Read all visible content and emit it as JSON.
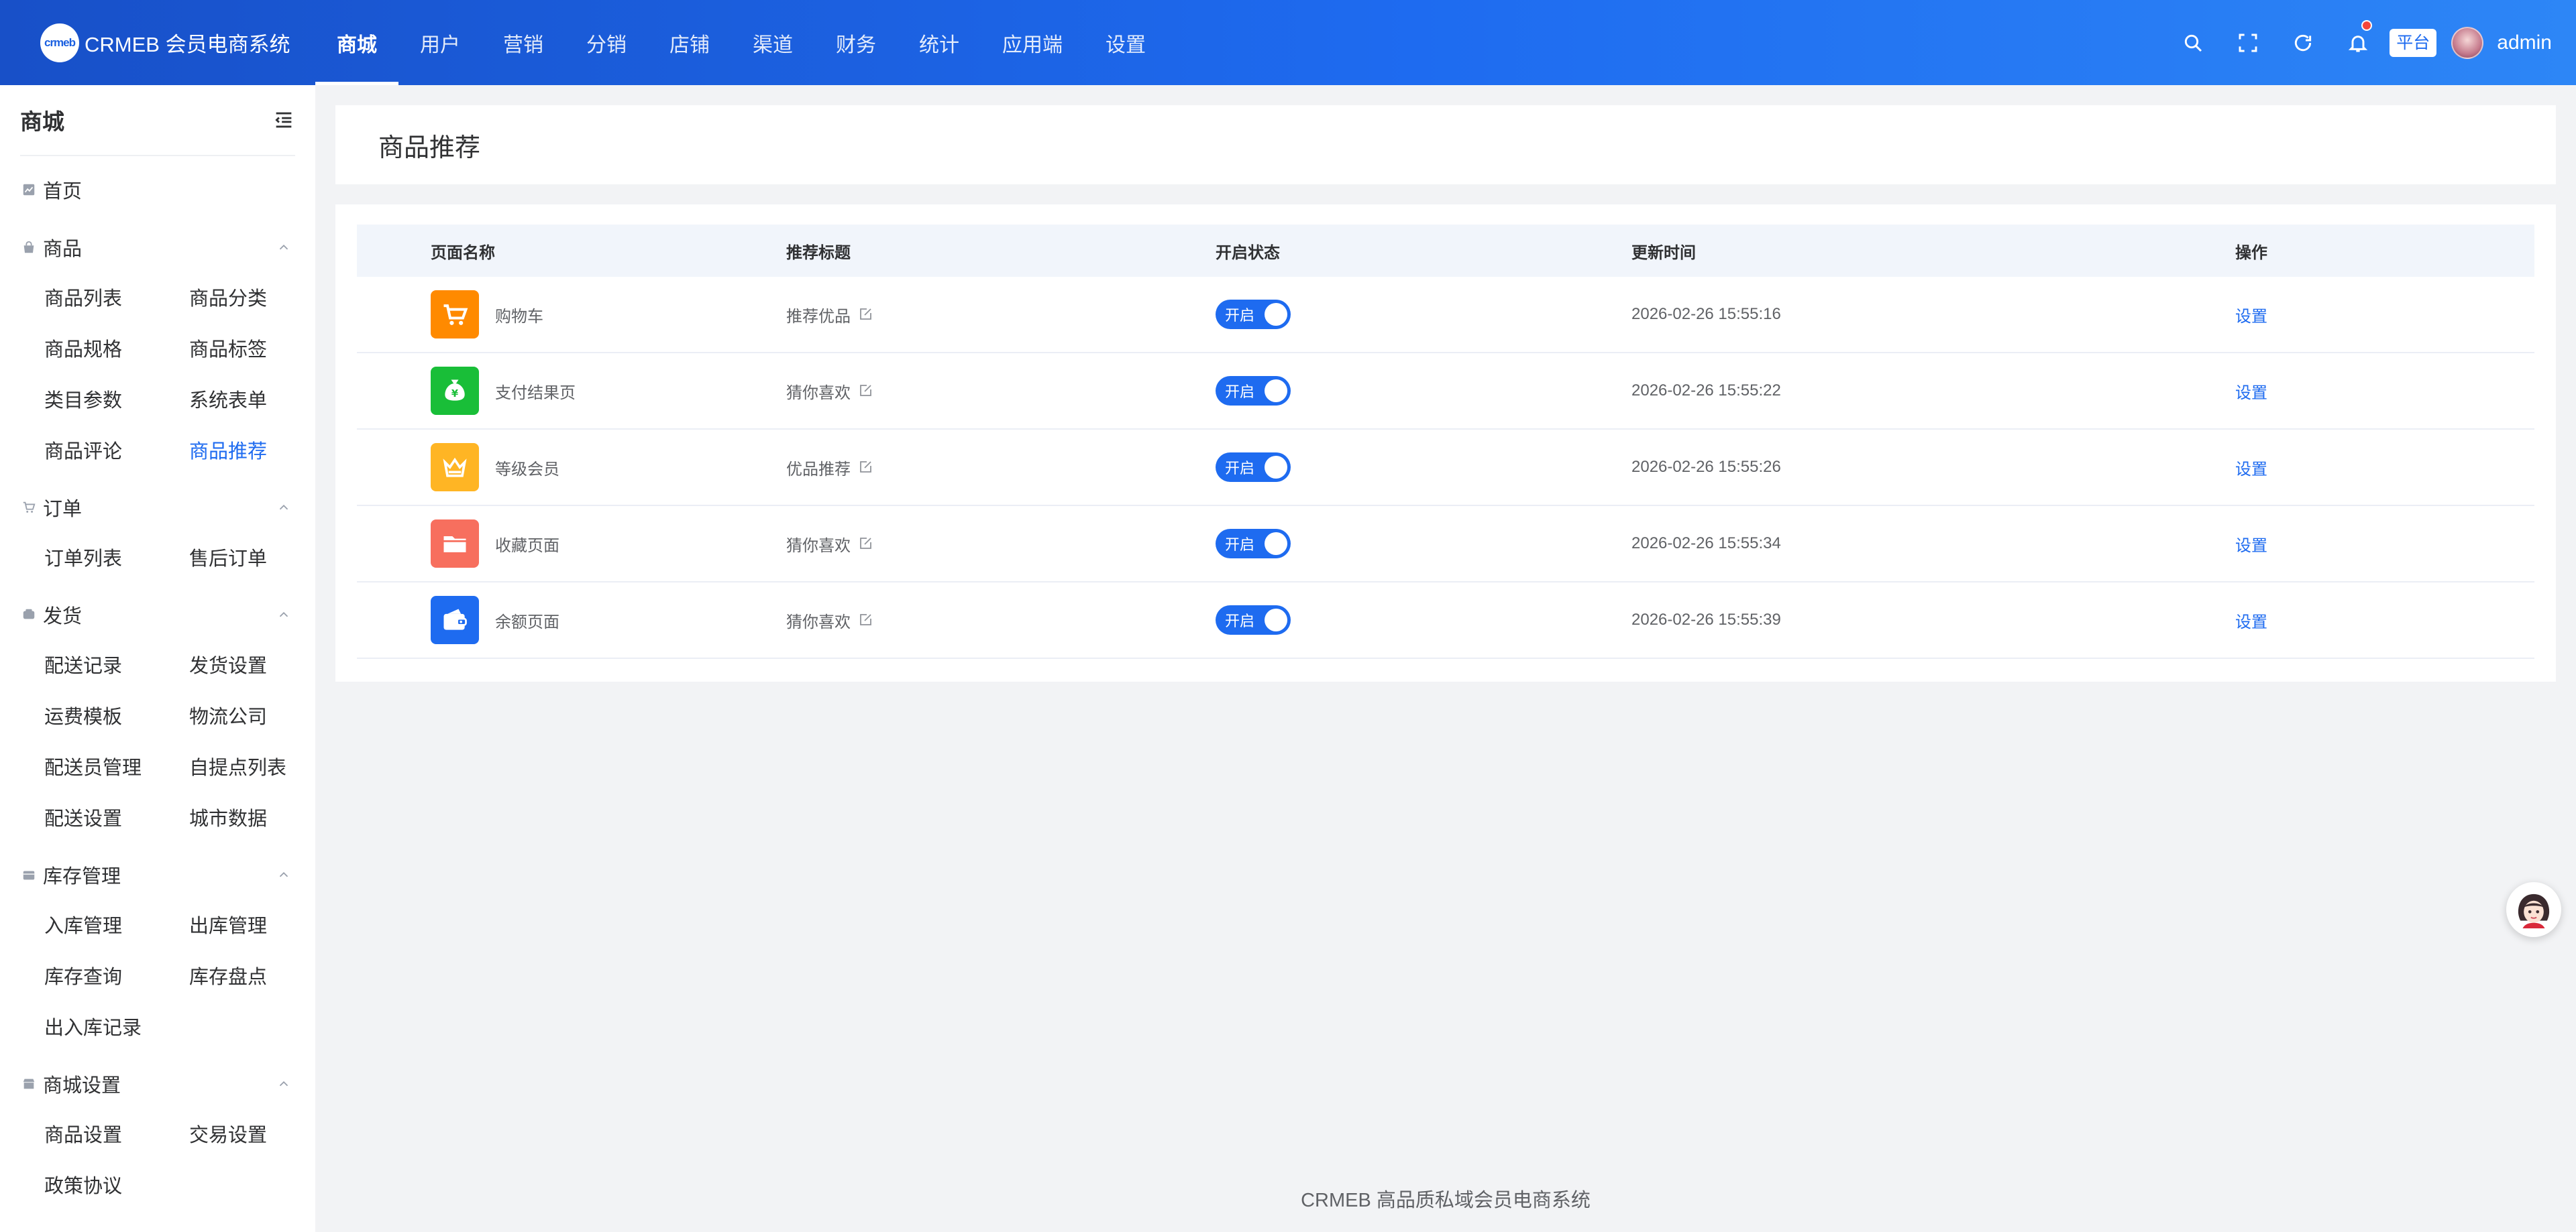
{
  "brand": {
    "logo_text": "crmeb",
    "title": "CRMEB 会员电商系统"
  },
  "topnav": [
    {
      "label": "商城",
      "active": true
    },
    {
      "label": "用户"
    },
    {
      "label": "营销"
    },
    {
      "label": "分销"
    },
    {
      "label": "店铺"
    },
    {
      "label": "渠道"
    },
    {
      "label": "财务"
    },
    {
      "label": "统计"
    },
    {
      "label": "应用端"
    },
    {
      "label": "设置"
    }
  ],
  "header_right": {
    "icons": [
      "search-icon",
      "fullscreen-icon",
      "refresh-icon",
      "bell-icon"
    ],
    "platform_badge": "平台",
    "username": "admin"
  },
  "sidebar": {
    "title": "商城",
    "home": "首页",
    "groups": [
      {
        "label": "商品",
        "items": [
          "商品列表",
          "商品分类",
          "商品规格",
          "商品标签",
          "类目参数",
          "系统表单",
          "商品评论",
          "商品推荐"
        ],
        "active": "商品推荐"
      },
      {
        "label": "订单",
        "items": [
          "订单列表",
          "售后订单"
        ]
      },
      {
        "label": "发货",
        "items": [
          "配送记录",
          "发货设置",
          "运费模板",
          "物流公司",
          "配送员管理",
          "自提点列表",
          "配送设置",
          "城市数据"
        ]
      },
      {
        "label": "库存管理",
        "items": [
          "入库管理",
          "出库管理",
          "库存查询",
          "库存盘点",
          "出入库记录"
        ]
      },
      {
        "label": "商城设置",
        "items": [
          "商品设置",
          "交易设置",
          "政策协议"
        ]
      }
    ]
  },
  "page": {
    "title": "商品推荐"
  },
  "table": {
    "headers": [
      "页面名称",
      "推荐标题",
      "开启状态",
      "更新时间",
      "操作"
    ],
    "rows": [
      {
        "name": "购物车",
        "title": "推荐优品",
        "status": "开启",
        "time": "2026-02-26 15:55:16",
        "action": "设置",
        "icon": "cart-icon",
        "color": "#ff8a00"
      },
      {
        "name": "支付结果页",
        "title": "猜你喜欢",
        "status": "开启",
        "time": "2026-02-26 15:55:22",
        "action": "设置",
        "icon": "money-bag-icon",
        "color": "#19be38"
      },
      {
        "name": "等级会员",
        "title": "优品推荐",
        "status": "开启",
        "time": "2026-02-26 15:55:26",
        "action": "设置",
        "icon": "crown-icon",
        "color": "#ffb524"
      },
      {
        "name": "收藏页面",
        "title": "猜你喜欢",
        "status": "开启",
        "time": "2026-02-26 15:55:34",
        "action": "设置",
        "icon": "folder-icon",
        "color": "#f76f5e"
      },
      {
        "name": "余额页面",
        "title": "猜你喜欢",
        "status": "开启",
        "time": "2026-02-26 15:55:39",
        "action": "设置",
        "icon": "wallet-icon",
        "color": "#1e6bf0"
      }
    ]
  },
  "footer": "CRMEB 高品质私域会员电商系统",
  "colors": {
    "accent": "#1e6bf0",
    "topbar_start": "#1850c8",
    "topbar_end": "#2d86f6"
  }
}
